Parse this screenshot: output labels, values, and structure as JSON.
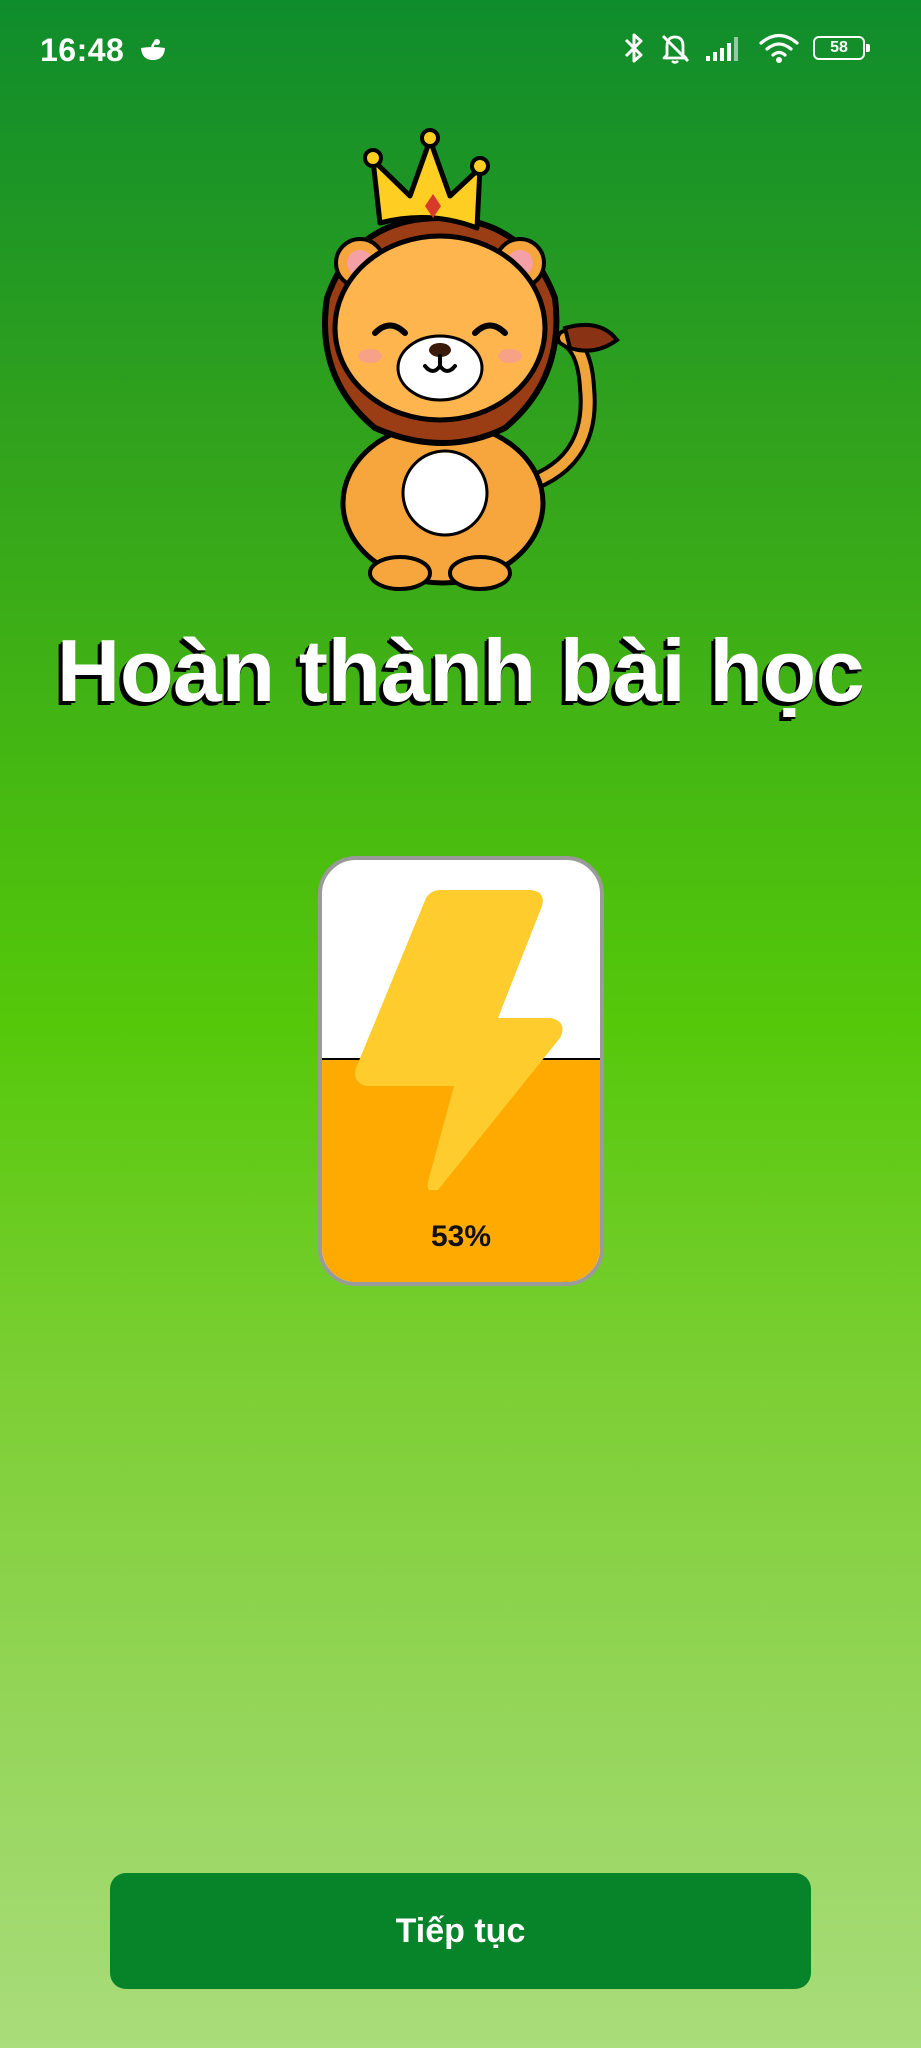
{
  "status_bar": {
    "time": "16:48",
    "battery_level": "58",
    "icons": [
      "app-notification-icon",
      "bluetooth-icon",
      "bell-off-icon",
      "signal-icon",
      "wifi-icon",
      "battery-icon"
    ]
  },
  "lesson_complete": {
    "title": "Hoàn thành bài học",
    "mascot": "lion-with-crown",
    "energy": {
      "icon": "lightning-bolt-icon",
      "percent_label": "53%",
      "fill_fraction": 0.53,
      "fill_color": "#ffaa00",
      "empty_color": "#ffffff"
    }
  },
  "actions": {
    "continue_label": "Tiếp tục"
  },
  "colors": {
    "background_top": "#0f8c2c",
    "background_mid": "#55c80a",
    "background_bottom": "#a9dc7a",
    "button": "#07832a",
    "bolt": "#ffcc2e"
  }
}
